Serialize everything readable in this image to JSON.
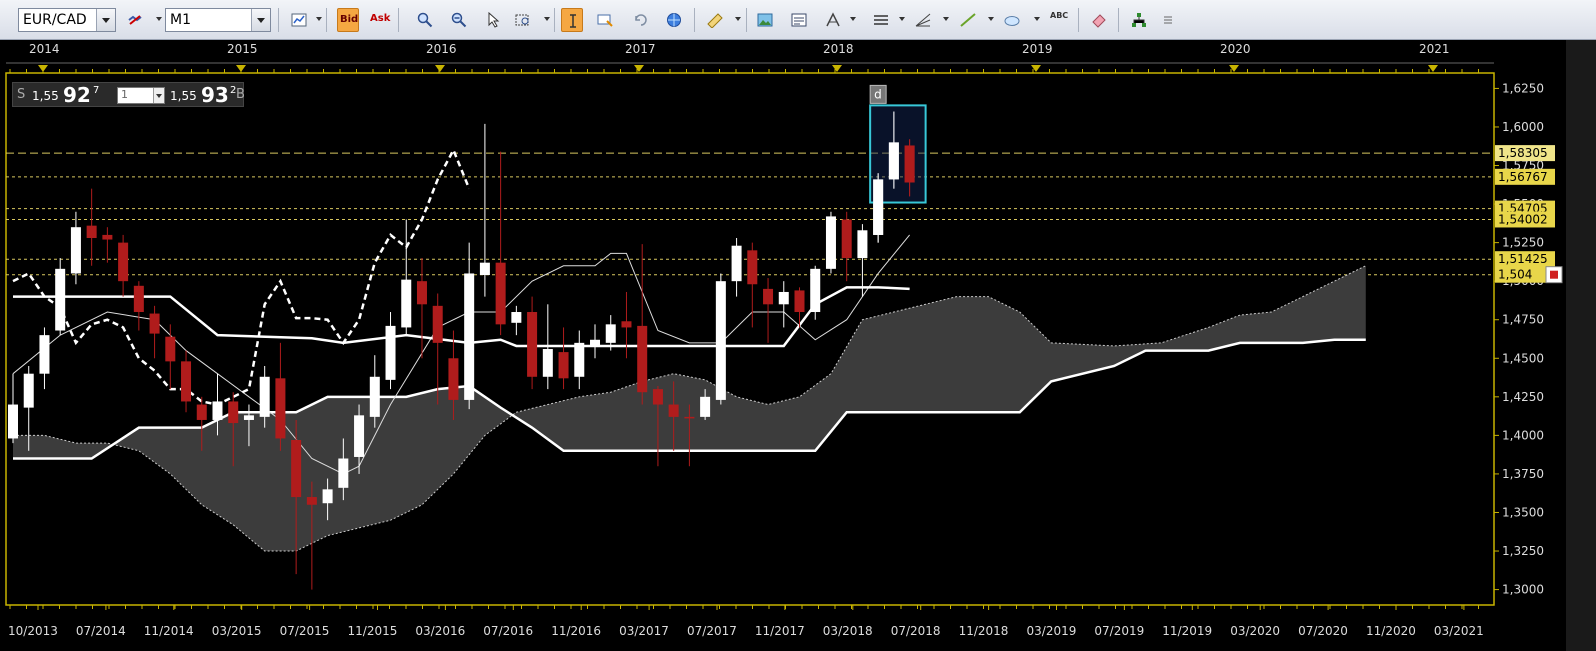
{
  "toolbar": {
    "symbol": "EUR/CAD",
    "timeframe": "M1",
    "bid_label": "Bid",
    "ask_label": "Ask",
    "abc_label": "ABC"
  },
  "quote": {
    "sell_label": "S",
    "sell_prefix": "1,55",
    "sell_big": "92",
    "sell_sup": "7",
    "lot_value": "1",
    "buy_prefix": "1,55",
    "buy_big": "93",
    "buy_sup": "2",
    "buy_label": "B"
  },
  "year_labels": [
    "2014",
    "2015",
    "2016",
    "2017",
    "2018",
    "2019",
    "2020",
    "2021"
  ],
  "date_labels": [
    "10/2013",
    "07/2014",
    "11/2014",
    "03/2015",
    "07/2015",
    "11/2015",
    "03/2016",
    "07/2016",
    "11/2016",
    "03/2017",
    "07/2017",
    "11/2017",
    "03/2018",
    "07/2018",
    "11/2018",
    "03/2019",
    "07/2019",
    "11/2019",
    "03/2020",
    "07/2020",
    "11/2020",
    "03/2021"
  ],
  "price_labels": [
    "1,6250",
    "1,6000",
    "1,5750",
    "1,5500",
    "1,5250",
    "1,5000",
    "1,4750",
    "1,4500",
    "1,4250",
    "1,4000",
    "1,3750",
    "1,3500",
    "1,3250",
    "1,3000"
  ],
  "level_labels": [
    {
      "text": "1,58305",
      "price": 1.58305
    },
    {
      "text": "1,56767",
      "price": 1.56767
    },
    {
      "text": "1,54705",
      "price": 1.54705
    },
    {
      "text": "1,54002",
      "price": 1.54002
    },
    {
      "text": "1,51425",
      "price": 1.51425
    },
    {
      "text": "1,504",
      "price": 1.5042
    }
  ],
  "marker_label": "d",
  "colors": {
    "bull": "#ffffff",
    "bear": "#b01c1c",
    "cloud": "#3c3c3c",
    "grid": "#c8b400",
    "level": "#d8c860",
    "select": "#38c8d8"
  },
  "chart_data": {
    "type": "candlestick",
    "symbol": "EUR/CAD",
    "ylim": [
      1.29,
      1.635
    ],
    "candles": [
      [
        1.398,
        1.42,
        1.395,
        1.44
      ],
      [
        1.418,
        1.44,
        1.39,
        1.445
      ],
      [
        1.44,
        1.465,
        1.43,
        1.47
      ],
      [
        1.468,
        1.508,
        1.465,
        1.515
      ],
      [
        1.505,
        1.535,
        1.498,
        1.545
      ],
      [
        1.536,
        1.528,
        1.51,
        1.56
      ],
      [
        1.53,
        1.527,
        1.512,
        1.535
      ],
      [
        1.525,
        1.5,
        1.49,
        1.53
      ],
      [
        1.497,
        1.48,
        1.468,
        1.5
      ],
      [
        1.479,
        1.466,
        1.45,
        1.484
      ],
      [
        1.464,
        1.448,
        1.43,
        1.472
      ],
      [
        1.448,
        1.422,
        1.415,
        1.455
      ],
      [
        1.42,
        1.41,
        1.39,
        1.425
      ],
      [
        1.41,
        1.422,
        1.4,
        1.44
      ],
      [
        1.422,
        1.408,
        1.38,
        1.428
      ],
      [
        1.41,
        1.413,
        1.393,
        1.42
      ],
      [
        1.412,
        1.438,
        1.405,
        1.445
      ],
      [
        1.437,
        1.398,
        1.39,
        1.46
      ],
      [
        1.397,
        1.36,
        1.31,
        1.41
      ],
      [
        1.36,
        1.355,
        1.3,
        1.37
      ],
      [
        1.356,
        1.365,
        1.345,
        1.372
      ],
      [
        1.366,
        1.385,
        1.358,
        1.398
      ],
      [
        1.386,
        1.413,
        1.375,
        1.42
      ],
      [
        1.412,
        1.438,
        1.405,
        1.452
      ],
      [
        1.436,
        1.471,
        1.43,
        1.48
      ],
      [
        1.47,
        1.501,
        1.465,
        1.54
      ],
      [
        1.5,
        1.485,
        1.45,
        1.515
      ],
      [
        1.484,
        1.46,
        1.42,
        1.492
      ],
      [
        1.45,
        1.423,
        1.41,
        1.468
      ],
      [
        1.423,
        1.505,
        1.417,
        1.525
      ],
      [
        1.504,
        1.512,
        1.49,
        1.602
      ],
      [
        1.512,
        1.472,
        1.465,
        1.584
      ],
      [
        1.473,
        1.48,
        1.465,
        1.484
      ],
      [
        1.48,
        1.438,
        1.43,
        1.49
      ],
      [
        1.438,
        1.456,
        1.43,
        1.485
      ],
      [
        1.454,
        1.437,
        1.43,
        1.47
      ],
      [
        1.438,
        1.46,
        1.43,
        1.468
      ],
      [
        1.458,
        1.462,
        1.45,
        1.472
      ],
      [
        1.46,
        1.472,
        1.455,
        1.478
      ],
      [
        1.474,
        1.47,
        1.45,
        1.493
      ],
      [
        1.471,
        1.428,
        1.42,
        1.524
      ],
      [
        1.43,
        1.42,
        1.38,
        1.432
      ],
      [
        1.42,
        1.412,
        1.39,
        1.435
      ],
      [
        1.412,
        1.411,
        1.38,
        1.42
      ],
      [
        1.412,
        1.425,
        1.41,
        1.43
      ],
      [
        1.423,
        1.5,
        1.42,
        1.505
      ],
      [
        1.5,
        1.523,
        1.49,
        1.528
      ],
      [
        1.52,
        1.498,
        1.47,
        1.525
      ],
      [
        1.495,
        1.485,
        1.46,
        1.502
      ],
      [
        1.485,
        1.493,
        1.47,
        1.5
      ],
      [
        1.494,
        1.48,
        1.47,
        1.496
      ],
      [
        1.48,
        1.508,
        1.475,
        1.51
      ],
      [
        1.508,
        1.542,
        1.505,
        1.545
      ],
      [
        1.54,
        1.515,
        1.5,
        1.545
      ],
      [
        1.515,
        1.533,
        1.49,
        1.537
      ],
      [
        1.53,
        1.566,
        1.525,
        1.57
      ],
      [
        1.566,
        1.59,
        1.56,
        1.61
      ],
      [
        1.588,
        1.564,
        1.555,
        1.592
      ]
    ],
    "tenkan": [
      [
        0,
        1.44
      ],
      [
        3,
        1.465
      ],
      [
        6,
        1.48
      ],
      [
        9,
        1.475
      ],
      [
        11,
        1.455
      ],
      [
        13,
        1.44
      ],
      [
        15,
        1.425
      ],
      [
        17,
        1.41
      ],
      [
        19,
        1.385
      ],
      [
        21,
        1.375
      ],
      [
        22,
        1.38
      ],
      [
        24,
        1.42
      ],
      [
        27,
        1.47
      ],
      [
        29,
        1.48
      ],
      [
        31,
        1.48
      ],
      [
        33,
        1.5
      ],
      [
        35,
        1.51
      ],
      [
        37,
        1.51
      ],
      [
        38,
        1.518
      ],
      [
        39,
        1.518
      ],
      [
        41,
        1.468
      ],
      [
        43,
        1.46
      ],
      [
        45,
        1.46
      ],
      [
        47,
        1.48
      ],
      [
        49,
        1.48
      ],
      [
        51,
        1.462
      ],
      [
        53,
        1.475
      ],
      [
        55,
        1.505
      ],
      [
        57,
        1.53
      ]
    ],
    "kijun": [
      [
        0,
        1.49
      ],
      [
        10,
        1.49
      ],
      [
        13,
        1.465
      ],
      [
        19,
        1.463
      ],
      [
        21,
        1.46
      ],
      [
        25,
        1.465
      ],
      [
        29,
        1.46
      ],
      [
        31,
        1.462
      ],
      [
        32,
        1.458
      ],
      [
        49,
        1.458
      ],
      [
        51,
        1.485
      ],
      [
        53,
        1.496
      ],
      [
        55,
        1.496
      ],
      [
        57,
        1.495
      ]
    ],
    "chikou": [
      [
        0,
        1.5
      ],
      [
        1,
        1.505
      ],
      [
        2,
        1.49
      ],
      [
        3,
        1.483
      ],
      [
        4,
        1.46
      ],
      [
        5,
        1.472
      ],
      [
        6,
        1.475
      ],
      [
        7,
        1.47
      ],
      [
        8,
        1.45
      ],
      [
        9,
        1.442
      ],
      [
        10,
        1.43
      ],
      [
        11,
        1.43
      ],
      [
        12,
        1.422
      ],
      [
        13,
        1.42
      ],
      [
        14,
        1.425
      ],
      [
        15,
        1.43
      ],
      [
        16,
        1.485
      ],
      [
        17,
        1.5
      ],
      [
        18,
        1.476
      ],
      [
        19,
        1.476
      ],
      [
        20,
        1.475
      ],
      [
        21,
        1.46
      ],
      [
        22,
        1.475
      ],
      [
        23,
        1.512
      ],
      [
        24,
        1.53
      ],
      [
        25,
        1.522
      ],
      [
        26,
        1.54
      ],
      [
        27,
        1.566
      ],
      [
        28,
        1.585
      ],
      [
        29,
        1.56
      ]
    ],
    "senkou_a": [
      [
        0,
        1.4
      ],
      [
        2,
        1.4
      ],
      [
        4,
        1.395
      ],
      [
        6,
        1.395
      ],
      [
        8,
        1.39
      ],
      [
        10,
        1.375
      ],
      [
        12,
        1.355
      ],
      [
        14,
        1.342
      ],
      [
        16,
        1.325
      ],
      [
        18,
        1.325
      ],
      [
        20,
        1.335
      ],
      [
        22,
        1.34
      ],
      [
        24,
        1.345
      ],
      [
        26,
        1.355
      ],
      [
        28,
        1.375
      ],
      [
        30,
        1.4
      ],
      [
        32,
        1.415
      ],
      [
        34,
        1.42
      ],
      [
        36,
        1.425
      ],
      [
        38,
        1.428
      ],
      [
        40,
        1.435
      ],
      [
        42,
        1.44
      ],
      [
        44,
        1.436
      ],
      [
        46,
        1.425
      ],
      [
        48,
        1.42
      ],
      [
        50,
        1.425
      ],
      [
        52,
        1.44
      ],
      [
        54,
        1.475
      ],
      [
        56,
        1.48
      ],
      [
        58,
        1.485
      ],
      [
        60,
        1.49
      ],
      [
        62,
        1.49
      ],
      [
        64,
        1.48
      ],
      [
        66,
        1.46
      ],
      [
        70,
        1.458
      ],
      [
        73,
        1.46
      ],
      [
        76,
        1.47
      ],
      [
        78,
        1.478
      ],
      [
        80,
        1.48
      ],
      [
        82,
        1.49
      ],
      [
        84,
        1.5
      ],
      [
        86,
        1.51
      ]
    ],
    "senkou_b": [
      [
        0,
        1.385
      ],
      [
        5,
        1.385
      ],
      [
        8,
        1.405
      ],
      [
        12,
        1.405
      ],
      [
        14,
        1.415
      ],
      [
        18,
        1.415
      ],
      [
        20,
        1.425
      ],
      [
        25,
        1.425
      ],
      [
        27,
        1.43
      ],
      [
        29,
        1.432
      ],
      [
        31,
        1.418
      ],
      [
        33,
        1.405
      ],
      [
        35,
        1.39
      ],
      [
        40,
        1.39
      ],
      [
        47,
        1.39
      ],
      [
        51,
        1.39
      ],
      [
        53,
        1.415
      ],
      [
        63,
        1.415
      ],
      [
        64,
        1.415
      ],
      [
        66,
        1.435
      ],
      [
        70,
        1.445
      ],
      [
        72,
        1.455
      ],
      [
        76,
        1.455
      ],
      [
        78,
        1.46
      ],
      [
        82,
        1.46
      ],
      [
        84,
        1.462
      ],
      [
        86,
        1.462
      ]
    ]
  }
}
